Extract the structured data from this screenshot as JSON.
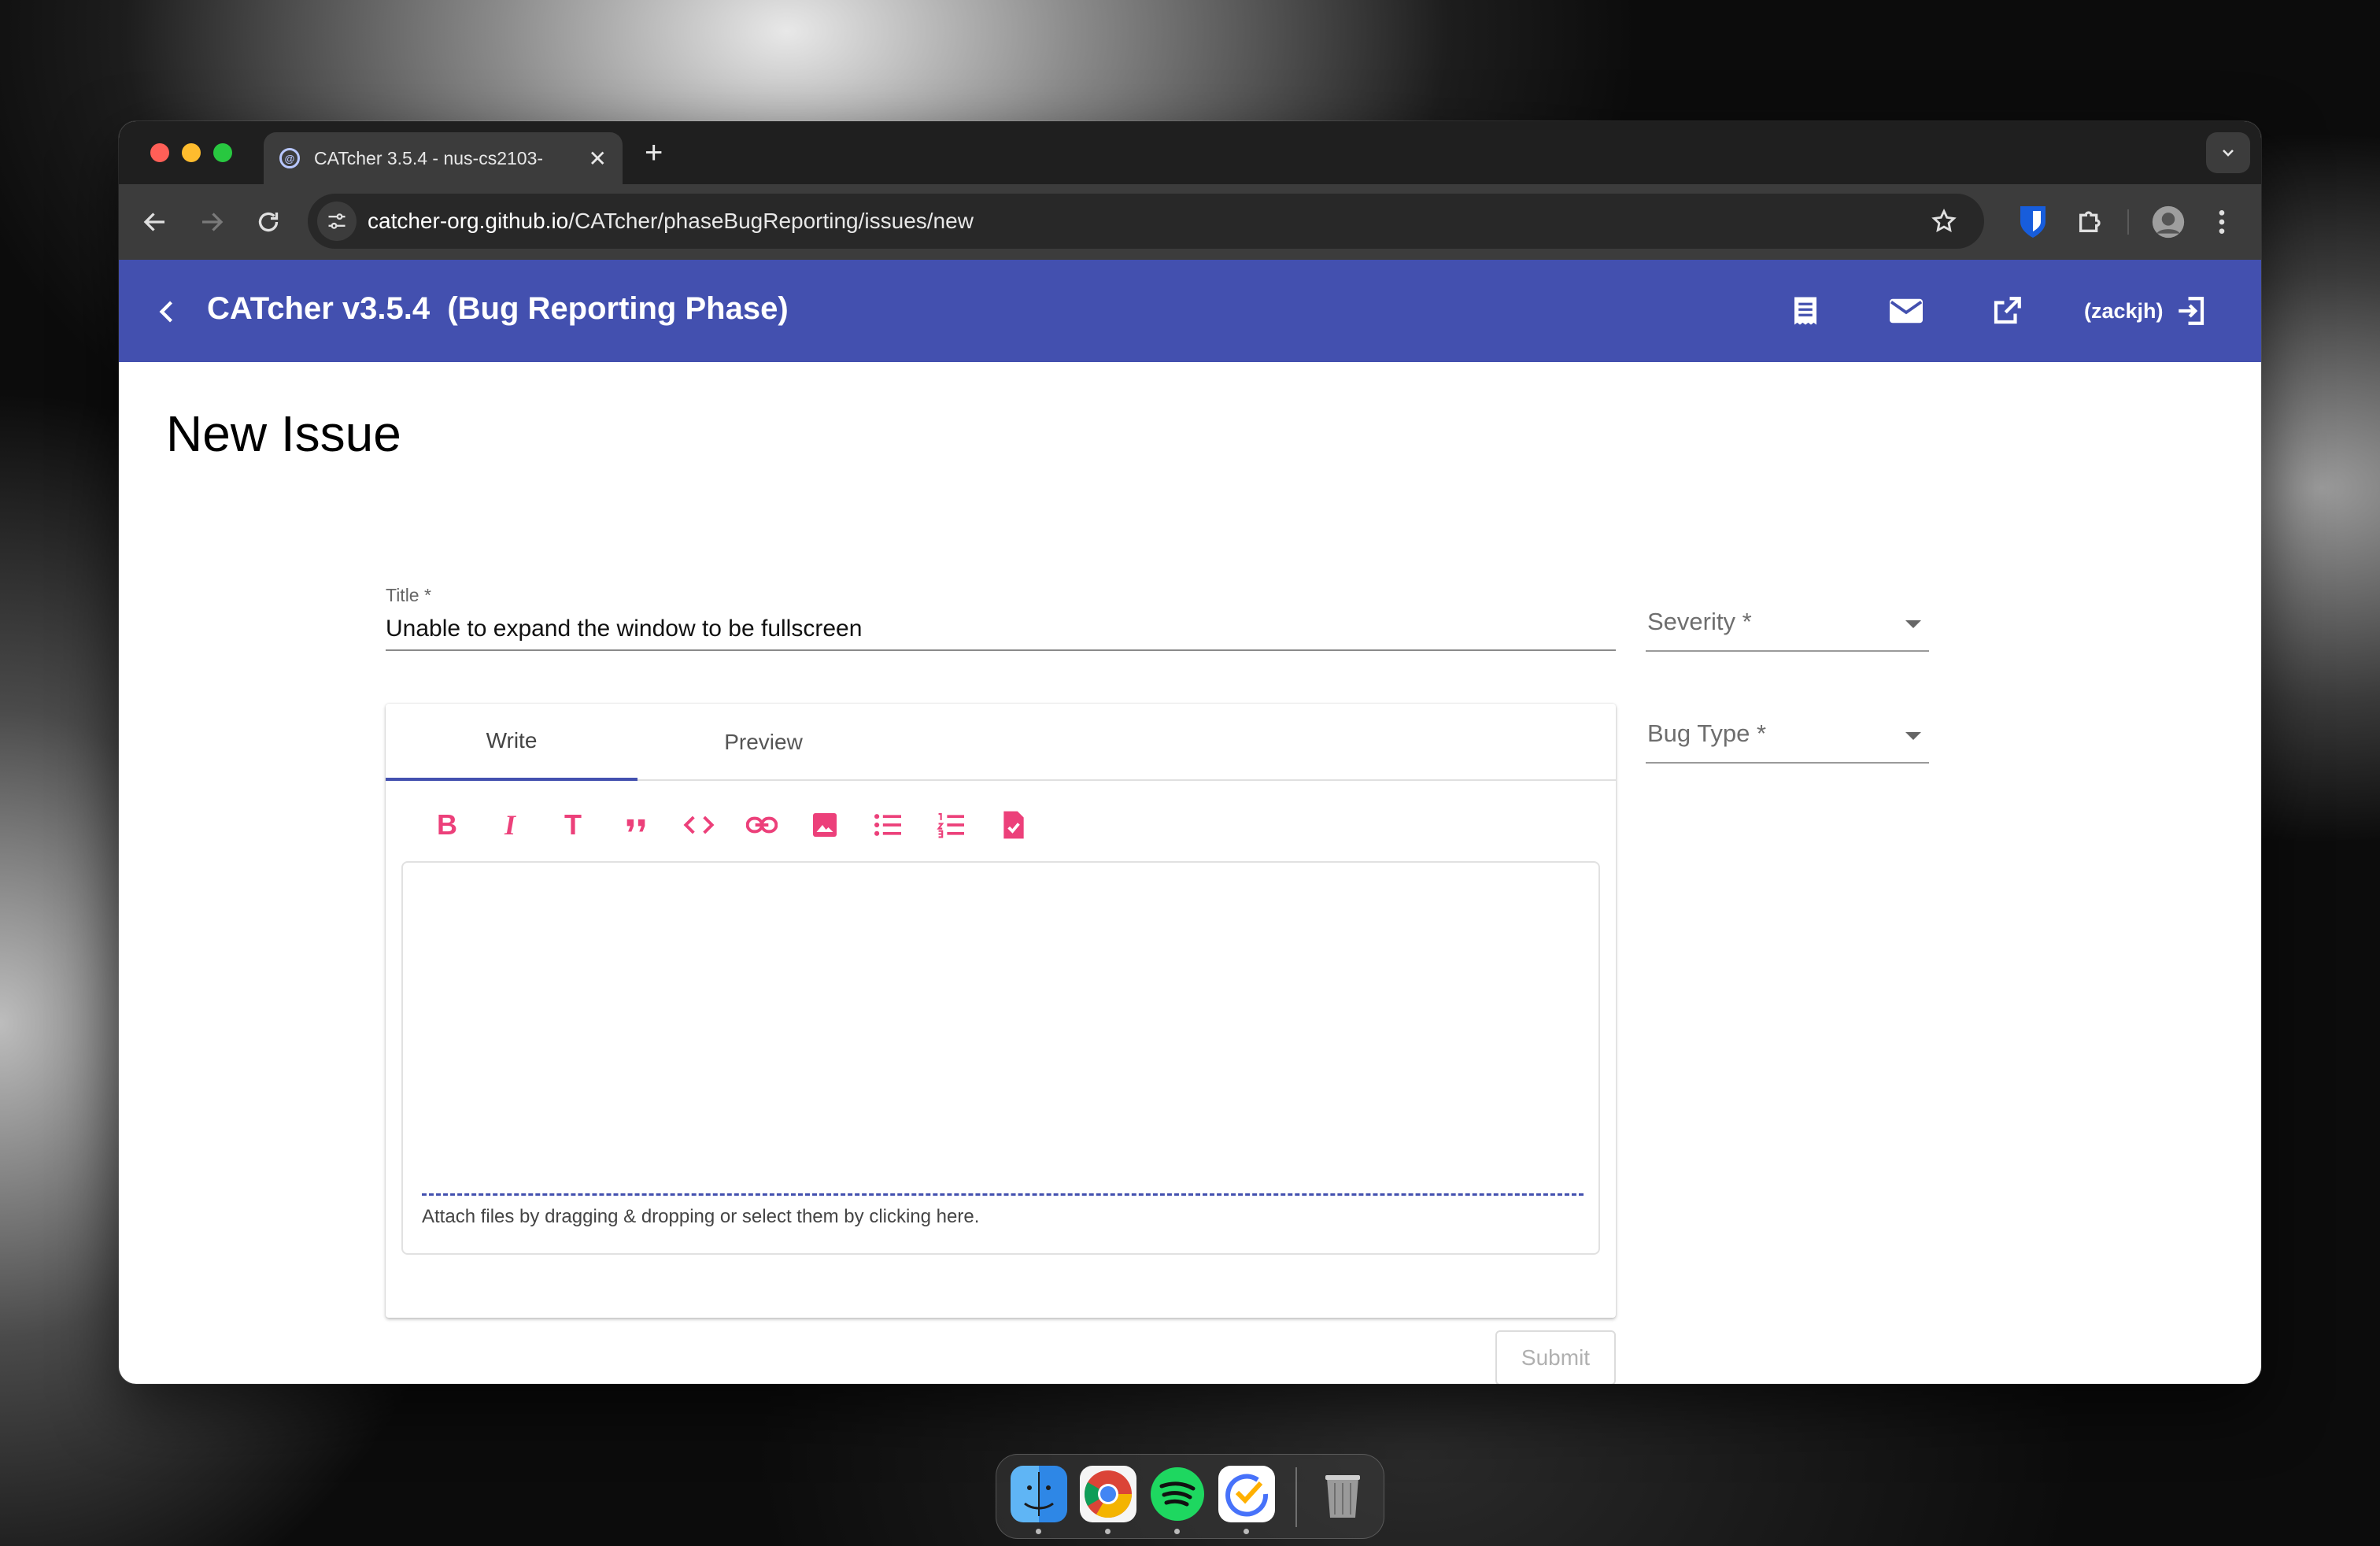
{
  "browser": {
    "tab_title": "CATcher 3.5.4 - nus-cs2103-",
    "tab_close": "✕",
    "new_tab": "+",
    "url_host": "catcher-org.github.io",
    "url_path": "/CATcher/phaseBugReporting/issues/new"
  },
  "app": {
    "title": "CATcher v3.5.4  (Bug Reporting Phase)",
    "user": "(zackjh)",
    "accent_color": "#4350af",
    "format_icon_color": "#ec407a"
  },
  "page": {
    "heading": "New Issue"
  },
  "form": {
    "title_label": "Title *",
    "title_value": "Unable to expand the window to be fullscreen",
    "severity_label": "Severity *",
    "bug_type_label": "Bug Type *",
    "tab_write": "Write",
    "tab_preview": "Preview",
    "format_bold": "B",
    "format_italic": "I",
    "format_heading": "T",
    "attach_hint": "Attach files by dragging & dropping or select them by clicking here.",
    "submit_label": "Submit"
  },
  "icons": {
    "format_toolbar": [
      "bold-icon",
      "italic-icon",
      "heading-icon",
      "quote-icon",
      "code-icon",
      "link-icon",
      "image-icon",
      "bullet-list-icon",
      "numbered-list-icon",
      "task-list-icon"
    ],
    "header_actions": [
      "list-icon",
      "mail-icon",
      "open-external-icon",
      "logout-icon"
    ],
    "dock": [
      "finder-icon",
      "chrome-icon",
      "spotify-icon",
      "ticktick-icon",
      "trash-icon"
    ]
  }
}
